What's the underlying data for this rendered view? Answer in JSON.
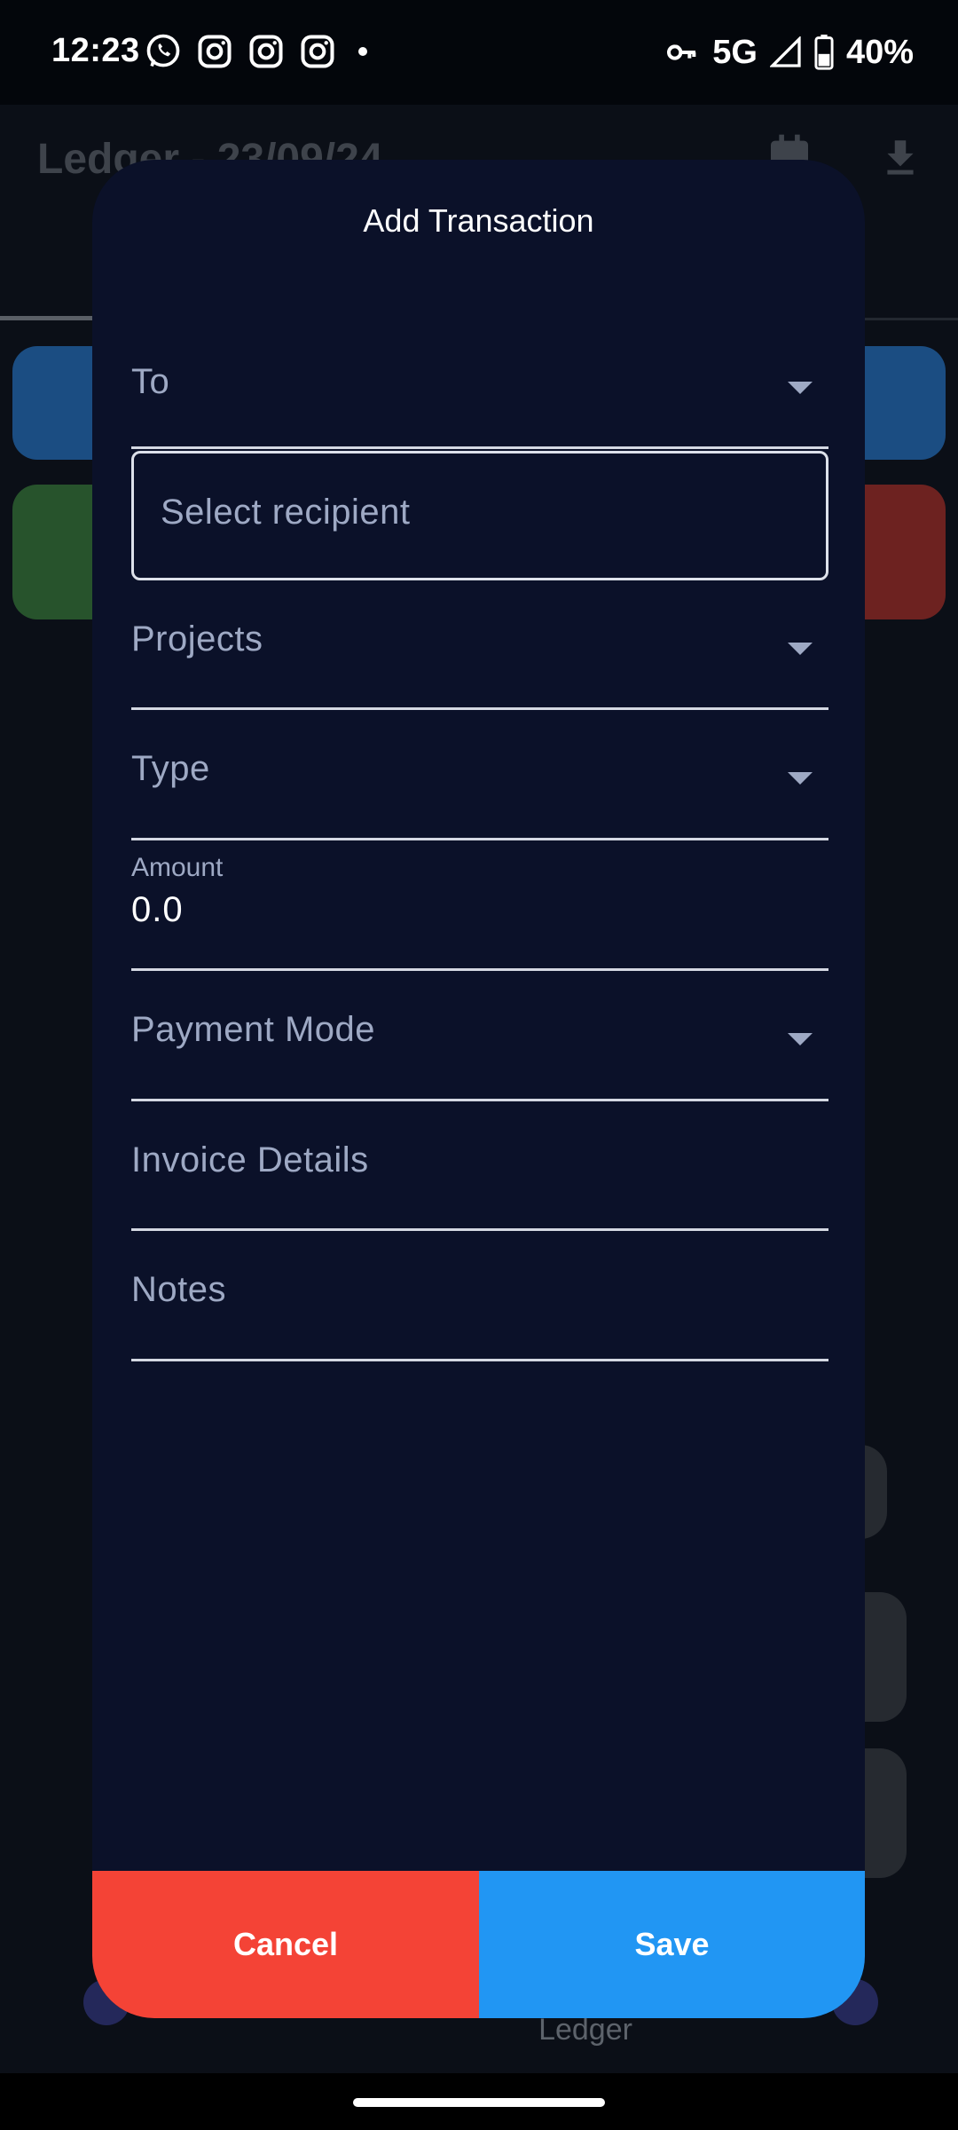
{
  "status_bar": {
    "time": "12:23",
    "network": "5G",
    "battery": "40%",
    "notification_icons": [
      "whatsapp-icon",
      "instagram-icon",
      "instagram-icon",
      "instagram-icon"
    ]
  },
  "background_app": {
    "title": "Ledger - 23/09/24",
    "nav_active_label": "Ledger"
  },
  "dialog": {
    "title": "Add Transaction",
    "fields": {
      "to": {
        "label": "To"
      },
      "recipient": {
        "placeholder": "Select recipient"
      },
      "projects": {
        "label": "Projects"
      },
      "type": {
        "label": "Type"
      },
      "amount": {
        "label": "Amount",
        "value": "0.0"
      },
      "payment_mode": {
        "label": "Payment Mode"
      },
      "invoice_details": {
        "label": "Invoice Details"
      },
      "notes": {
        "label": "Notes"
      }
    },
    "buttons": {
      "cancel": "Cancel",
      "save": "Save"
    }
  },
  "colors": {
    "dialog_bg": "#0b1129",
    "cancel": "#f44336",
    "save": "#2196f3",
    "label": "#9ea9c4"
  }
}
